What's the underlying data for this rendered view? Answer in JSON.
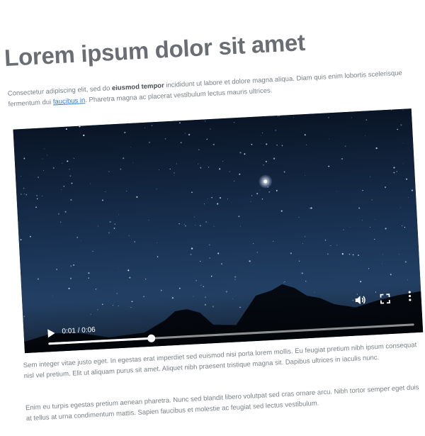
{
  "article": {
    "title": "Lorem ipsum dolor sit amet",
    "intro": {
      "text_before": "Consectetur adipiscing elit, sed do ",
      "bold": "eiusmod tempor",
      "text_middle": " incididunt ut labore et dolore magna aliqua. Diam quis enim lobortis scelerisque fermentum dui ",
      "link": "faucibus in",
      "text_after": ". Pharetra magna ac placerat vestibulum lectus mauris ultrices."
    },
    "paragraph_1": "Sem integer vitae justo eget. In egestas erat imperdiet sed euismod nisi porta lorem mollis. Eu feugiat pretium nibh ipsum consequat nisl vel pretium. Elit ut aliquam purus sit amet. Aliquet nibh praesent tristique magna sit. Dapibus ultrices in iaculis nunc.",
    "paragraph_2": "Enim eu turpis egestas pretium aenean pharetra. Nunc sed blandit libero volutpat sed cras ornare arcu. Nibh tortor semper eget duis at tellus at urna condimentum mattis. Sapien faucibus et molestie ac feugiat sed lectus vestibulum."
  },
  "video_player": {
    "time": "0:01 / 0:06",
    "progress": 0.28,
    "icons": {
      "play": "play-icon",
      "volume": "volume-icon",
      "fullscreen": "fullscreen-icon",
      "more": "more-options-icon"
    }
  }
}
